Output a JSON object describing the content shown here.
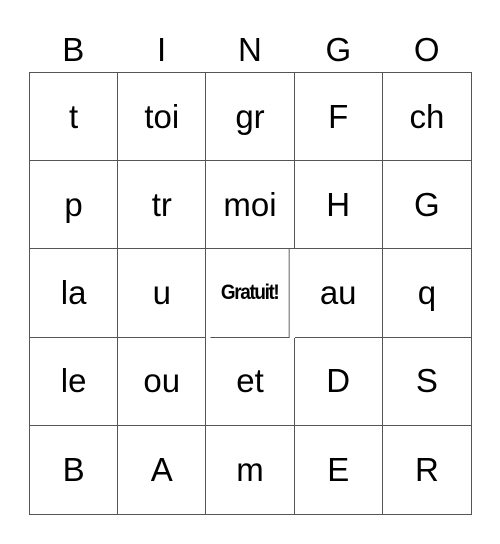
{
  "header": [
    "B",
    "I",
    "N",
    "G",
    "O"
  ],
  "cells": [
    [
      "t",
      "toi",
      "gr",
      "F",
      "ch"
    ],
    [
      "p",
      "tr",
      "moi",
      "H",
      "G"
    ],
    [
      "la",
      "u",
      "Gratuit!",
      "au",
      "q"
    ],
    [
      "le",
      "ou",
      "et",
      "D",
      "S"
    ],
    [
      "B",
      "A",
      "m",
      "E",
      "R"
    ]
  ],
  "free_space": {
    "row": 2,
    "col": 2
  }
}
